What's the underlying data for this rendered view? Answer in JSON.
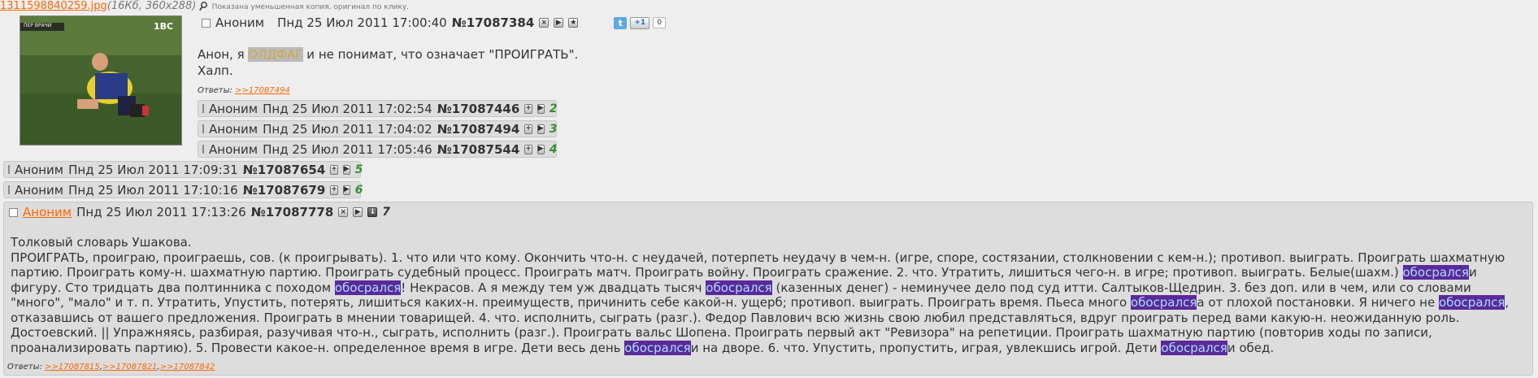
{
  "op": {
    "file_name": "1311598840259.jpg",
    "file_meta": "(16Кб, 360x288)",
    "file_note": "Показана уменьшенная копия, оригинал по клику.",
    "thumb_logo": "1BC",
    "thumb_overlay": "ПЕР ВРАЧИ",
    "author": "Аноним",
    "date": "Пнд 25 Июл 2011 17:00:40",
    "number": "№17087384",
    "share_count": "0",
    "text_prefix": "Анон, я ",
    "text_spoiler": "ОЛДФАГ",
    "text_suffix": " и не понимат, что означает \"ПРОИГРАТЬ\".",
    "text_line2": "Халп.",
    "answers_label": "Ответы:",
    "answers": [
      ">>17087494"
    ]
  },
  "replies": [
    {
      "author": "Аноним",
      "date": "Пнд 25 Июл 2011 17:02:54",
      "number": "№17087446",
      "index": "2"
    },
    {
      "author": "Аноним",
      "date": "Пнд 25 Июл 2011 17:04:02",
      "number": "№17087494",
      "index": "3"
    },
    {
      "author": "Аноним",
      "date": "Пнд 25 Июл 2011 17:05:46",
      "number": "№17087544",
      "index": "4"
    },
    {
      "author": "Аноним",
      "date": "Пнд 25 Июл 2011 17:09:31",
      "number": "№17087654",
      "index": "5"
    },
    {
      "author": "Аноним",
      "date": "Пнд 25 Июл 2011 17:10:16",
      "number": "№17087679",
      "index": "6"
    }
  ],
  "last": {
    "author": "Аноним",
    "date": "Пнд 25 Июл 2011 17:13:26",
    "number": "№17087778",
    "index": "7",
    "title": "Толковый словарь Ушакова.",
    "hl": "обосрался",
    "segs": [
      "ПРОИГРАТЬ, проиграю, проиграешь, сов. (к проигрывать). 1. что или что кому. Окончить что-н. с неудачей, потерпеть неудачу в чем-н. (игре, споре, состязании, столкновении с кем-н.); противоп. выиграть. Проиграть шахматную партию. Проиграть кому-н. шахматную партию. Проиграть судебный процесс. Проиграть матч. Проиграть войну. Проиграть сражение. 2. что. Утратить, лишиться чего-н. в игре; противоп. выиграть. Белые(шахм.) ",
      "и фигуру. Сто тридцать два полтинника с походом ",
      "! Некрасов. А я между тем уж двадцать тысяч ",
      " (казенных денег) - неминучее дело под суд итти. Салтыков-Щедрин. 3. без доп. или в чем, или со словами \"много\", \"мало\" и т. п. Утратить, Упустить, потерять, лишиться каких-н. преимуществ, причинить себе какой-н. ущерб; противоп. выиграть. Проиграть время. Пьеса много ",
      "а от плохой постановки. Я ничего не ",
      ", отказавшись от вашего предложения. Проиграть в мнении товарищей. 4. что. исполнить, сыграть (разг.). Федор Павлович всю жизнь свою любил представляться, вдруг проиграть перед вами какую-н. неожиданную роль. Достоевский. || Упражняясь, разбирая, разучивая что-н., сыграть, исполнить (разг.). Проиграть вальс Шопена. Проиграть первый акт \"Ревизора\" на репетиции. Проиграть шахматную партию (повторив ходы по записи, проанализировать партию). 5. Провести какое-н. определенное время в игре. Дети весь день ",
      "и на дворе. 6. что. Упустить, пропустить, играя, увлекшись игрой. Дети ",
      "и обед."
    ],
    "answers_label": "Ответы:",
    "answers": [
      ">>17087815",
      ">>17087821",
      ">>17087842"
    ]
  }
}
